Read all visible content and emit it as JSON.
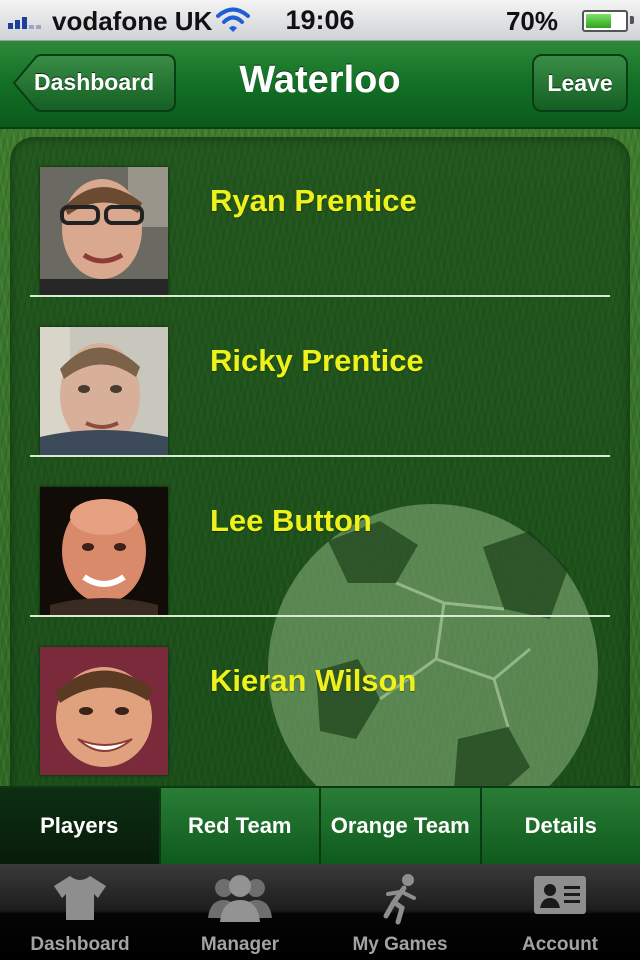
{
  "status_bar": {
    "carrier": "vodafone UK",
    "time": "19:06",
    "battery_percent": "70%",
    "battery_level": 0.7
  },
  "nav": {
    "title": "Waterloo",
    "back_label": "Dashboard",
    "leave_label": "Leave"
  },
  "players": [
    {
      "name": "Ryan Prentice",
      "avatar": "photo-young-man-glasses"
    },
    {
      "name": "Ricky Prentice",
      "avatar": "photo-young-man-short-hair"
    },
    {
      "name": "Lee Button",
      "avatar": "photo-bald-man"
    },
    {
      "name": "Kieran Wilson",
      "avatar": "photo-smiling-man"
    }
  ],
  "segments": [
    {
      "label": "Players",
      "active": true
    },
    {
      "label": "Red Team",
      "active": false
    },
    {
      "label": "Orange Team",
      "active": false
    },
    {
      "label": "Details",
      "active": false
    }
  ],
  "tab_bar": [
    {
      "label": "Dashboard",
      "icon": "shirt-icon"
    },
    {
      "label": "Manager",
      "icon": "people-icon"
    },
    {
      "label": "My Games",
      "icon": "runner-icon"
    },
    {
      "label": "Account",
      "icon": "id-card-icon"
    }
  ],
  "colors": {
    "nav_green": "#127025",
    "player_name": "#eef21a",
    "tab_label": "#a3a3a3"
  }
}
